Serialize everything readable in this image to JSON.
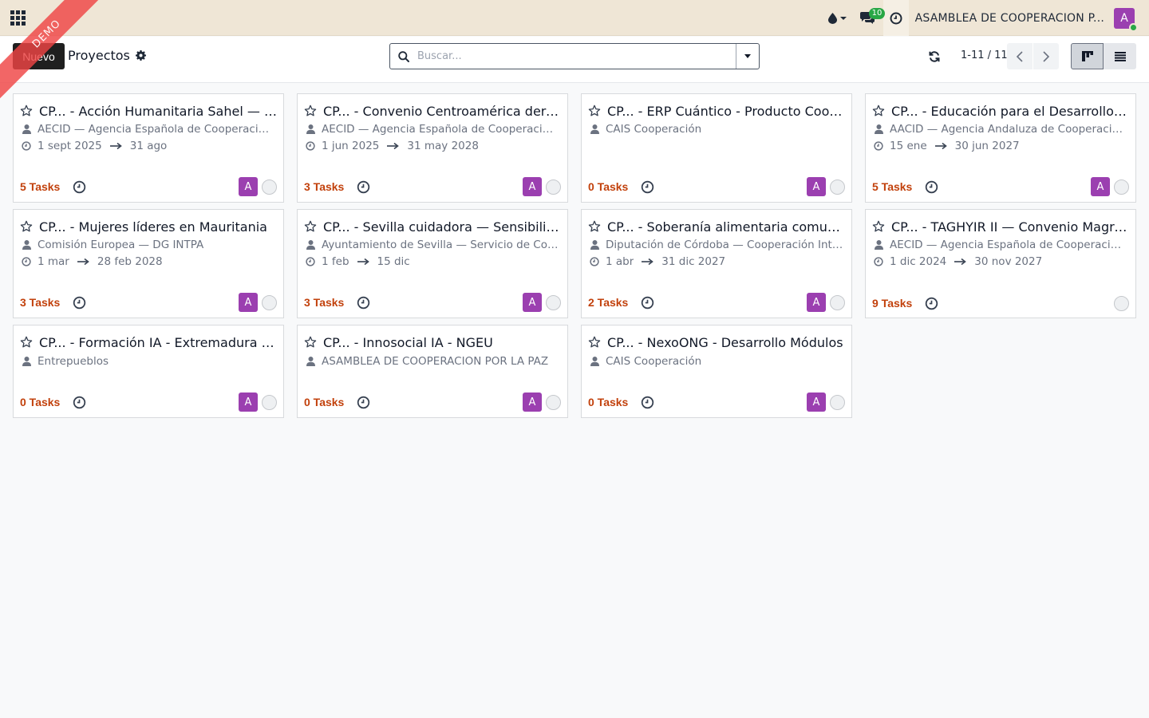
{
  "navbar": {
    "company": "ASAMBLEA DE COOPERACION P...",
    "messages_count": "10",
    "avatar_letter": "A",
    "icons": [
      "apps-icon",
      "drop-icon",
      "chat-icon",
      "clock-icon"
    ]
  },
  "ribbon": {
    "label": "DEMO"
  },
  "control": {
    "new_button": "Nuevo",
    "breadcrumb": "Proyectos",
    "search_placeholder": "Buscar...",
    "pager": "1-11 / 11"
  },
  "colors": {
    "accent": "#9b3fb0",
    "tasks": "#c2410c",
    "navbar": "#efe6d6",
    "ribbon": "#ef4444",
    "badge": "#28a745"
  },
  "cards": [
    {
      "title": "CP... - Acción Humanitaria Sahel — Convenio",
      "partner": "AECID — Agencia Española de Cooperación Internacional",
      "start": "1 sept 2025",
      "end": "31 ago",
      "tasks": "5 Tasks",
      "avatar": "A"
    },
    {
      "title": "CP... - Convenio Centroamérica derechos",
      "partner": "AECID — Agencia Española de Cooperación Internacional",
      "start": "1 jun 2025",
      "end": "31 may 2028",
      "tasks": "3 Tasks",
      "avatar": "A"
    },
    {
      "title": "CP... - ERP Cuántico - Producto Cooperación",
      "partner": "CAIS Cooperación",
      "start": "",
      "end": "",
      "tasks": "0 Tasks",
      "avatar": "A"
    },
    {
      "title": "CP... - Educación para el Desarrollo Andalucía",
      "partner": "AACID — Agencia Andaluza de Cooperación Internacional",
      "start": "15 ene",
      "end": "30 jun 2027",
      "tasks": "5 Tasks",
      "avatar": "A"
    },
    {
      "title": "CP... - Mujeres líderes en Mauritania",
      "partner": "Comisión Europea — DG INTPA",
      "start": "1 mar",
      "end": "28 feb 2028",
      "tasks": "3 Tasks",
      "avatar": "A"
    },
    {
      "title": "CP... - Sevilla cuidadora — Sensibilización",
      "partner": "Ayuntamiento de Sevilla — Servicio de Cooperación",
      "start": "1 feb",
      "end": "15 dic",
      "tasks": "3 Tasks",
      "avatar": "A"
    },
    {
      "title": "CP... - Soberanía alimentaria comunitaria",
      "partner": "Diputación de Córdoba — Cooperación Internacional",
      "start": "1 abr",
      "end": "31 dic 2027",
      "tasks": "2 Tasks",
      "avatar": "A"
    },
    {
      "title": "CP... - TAGHYIR II — Convenio Magreb",
      "partner": "AECID — Agencia Española de Cooperación Internacional",
      "start": "1 dic 2024",
      "end": "30 nov 2027",
      "tasks": "9 Tasks",
      "avatar": ""
    },
    {
      "title": "CP... - Formación IA - Extremadura Rural",
      "partner": "Entrepueblos",
      "start": "",
      "end": "",
      "tasks": "0 Tasks",
      "avatar": "A"
    },
    {
      "title": "CP... - Innosocial IA - NGEU",
      "partner": "ASAMBLEA DE COOPERACION POR LA PAZ",
      "start": "",
      "end": "",
      "tasks": "0 Tasks",
      "avatar": "A"
    },
    {
      "title": "CP... - NexoONG - Desarrollo Módulos",
      "partner": "CAIS Cooperación",
      "start": "",
      "end": "",
      "tasks": "0 Tasks",
      "avatar": "A"
    }
  ]
}
